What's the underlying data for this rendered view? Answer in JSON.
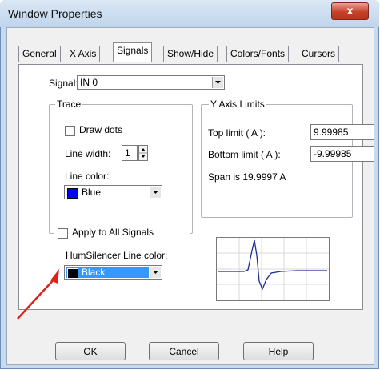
{
  "window": {
    "title": "Window Properties",
    "close_glyph": "x"
  },
  "tabs": [
    {
      "label": "General"
    },
    {
      "label": "X Axis"
    },
    {
      "label": "Signals"
    },
    {
      "label": "Show/Hide"
    },
    {
      "label": "Colors/Fonts"
    },
    {
      "label": "Cursors"
    }
  ],
  "signal": {
    "label": "Signal:",
    "value": "IN 0"
  },
  "trace": {
    "title": "Trace",
    "draw_dots_label": "Draw dots",
    "line_width_label": "Line width:",
    "line_width_value": "1",
    "line_color_label": "Line color:",
    "line_color_value": "Blue",
    "line_color_hex": "#0000ff"
  },
  "apply_all_label": "Apply to All Signals",
  "y_axis": {
    "title": "Y Axis Limits",
    "top_label": "Top limit ( A ):",
    "top_value": "9.99985",
    "bottom_label": "Bottom limit ( A ):",
    "bottom_value": "-9.99985",
    "span_text": "Span is 19.9997 A"
  },
  "humsilencer": {
    "label": "HumSilencer Line color:",
    "value": "Black",
    "color_hex": "#000000",
    "highlight_hex": "#3399ff"
  },
  "buttons": {
    "ok": "OK",
    "cancel": "Cancel",
    "help": "Help"
  },
  "annotation": {
    "arrow_color": "#e0201b"
  }
}
